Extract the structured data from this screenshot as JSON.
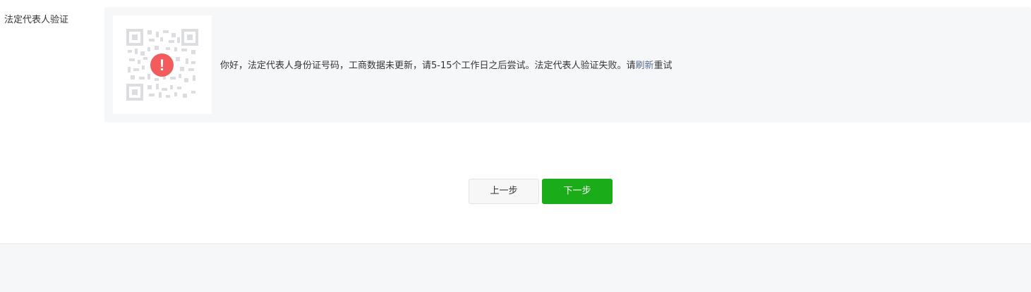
{
  "field": {
    "label": "法定代表人验证"
  },
  "verification": {
    "message_before_link": "你好，法定代表人身份证号码，工商数据未更新，请5-15个工作日之后尝试。法定代表人验证失败。请",
    "refresh_link": "刷新",
    "message_after_link": "重试",
    "warning_symbol": "!",
    "icon": "warning-icon",
    "colors": {
      "warning": "#f25c5c",
      "link": "#576b95"
    }
  },
  "actions": {
    "prev_label": "上一步",
    "next_label": "下一步",
    "colors": {
      "primary": "#1aad19"
    }
  }
}
